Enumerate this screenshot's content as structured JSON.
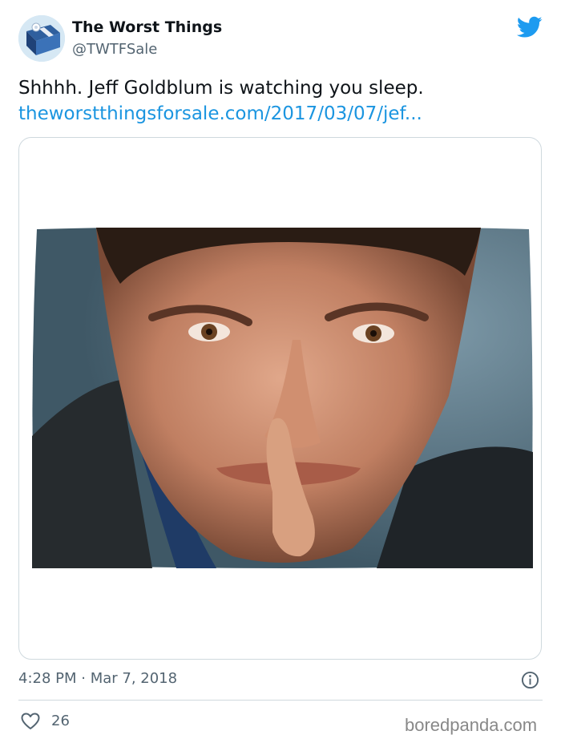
{
  "tweet": {
    "author": {
      "display_name": "The Worst Things",
      "handle": "@TWTFSale",
      "avatar_icon": "gift-box-avatar"
    },
    "text": "Shhhh. Jeff Goldblum is watching you sleep.",
    "link_text": "theworstthingsforsale.com/2017/03/07/jef...",
    "media": {
      "description_icon": "pillow-photo"
    },
    "timestamp": "4:28 PM · Mar 7, 2018",
    "likes": "26"
  },
  "watermark": "boredpanda.com",
  "colors": {
    "link": "#1b95e0",
    "twitter_blue": "#1d9bf0",
    "muted": "#536471",
    "border": "#cfd9de"
  }
}
